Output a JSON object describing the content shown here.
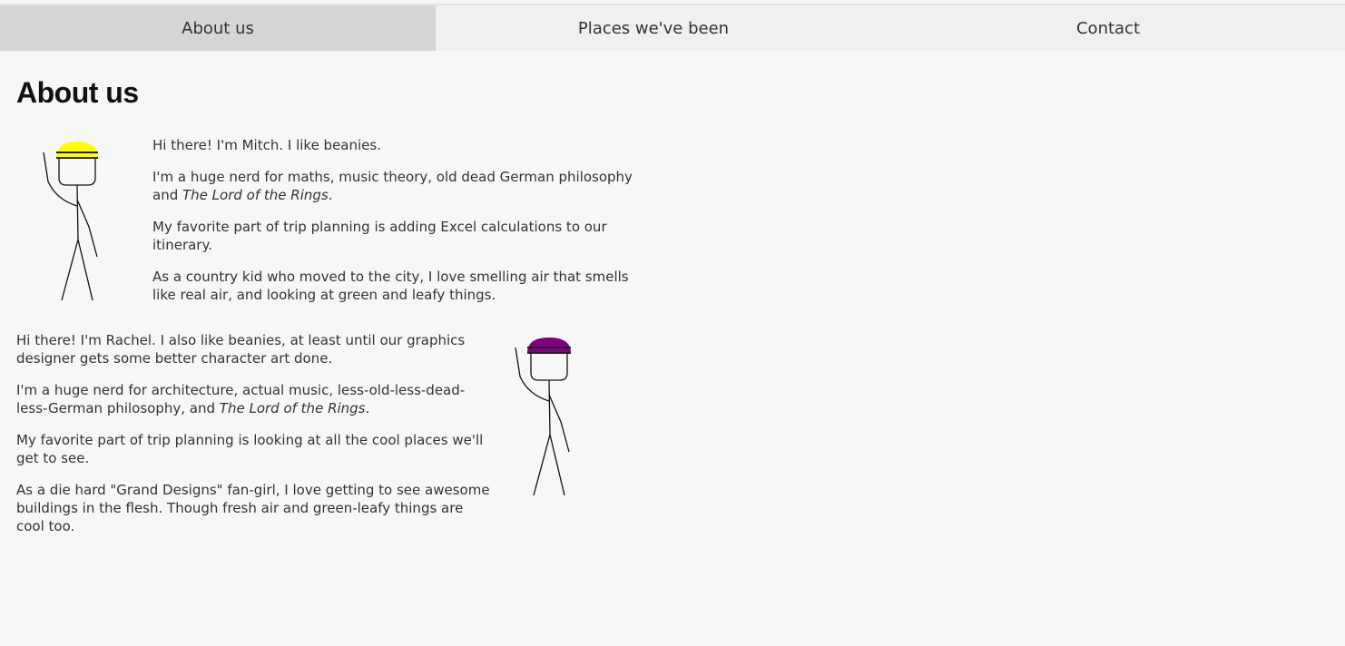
{
  "nav": {
    "items": [
      {
        "label": "About us",
        "active": true
      },
      {
        "label": "Places we've been",
        "active": false
      },
      {
        "label": "Contact",
        "active": false
      }
    ]
  },
  "page": {
    "title": "About us"
  },
  "bios": {
    "mitch": {
      "hat_color": "#ffff00",
      "p1": "Hi there! I'm Mitch. I like beanies.",
      "p2_before": "I'm a huge nerd for maths, music theory, old dead German philosophy and ",
      "p2_em": "The Lord of the Rings",
      "p2_after": ".",
      "p3": "My favorite part of trip planning is adding Excel calculations to our itinerary.",
      "p4": "As a country kid who moved to the city, I love smelling air that smells like real air, and looking at green and leafy things."
    },
    "rachel": {
      "hat_color": "#800080",
      "p1": "Hi there! I'm Rachel. I also like beanies, at least until our graphics designer gets some better character art done.",
      "p2_before": "I'm a huge nerd for architecture, actual music, less-old-less-dead-less-German philosophy, and ",
      "p2_em": "The Lord of the Rings",
      "p2_after": ".",
      "p3": "My favorite part of trip planning is looking at all the cool places we'll get to see.",
      "p4": "As a die hard \"Grand Designs\" fan-girl, I love getting to see awesome buildings in the flesh. Though fresh air and green-leafy things are cool too."
    }
  }
}
